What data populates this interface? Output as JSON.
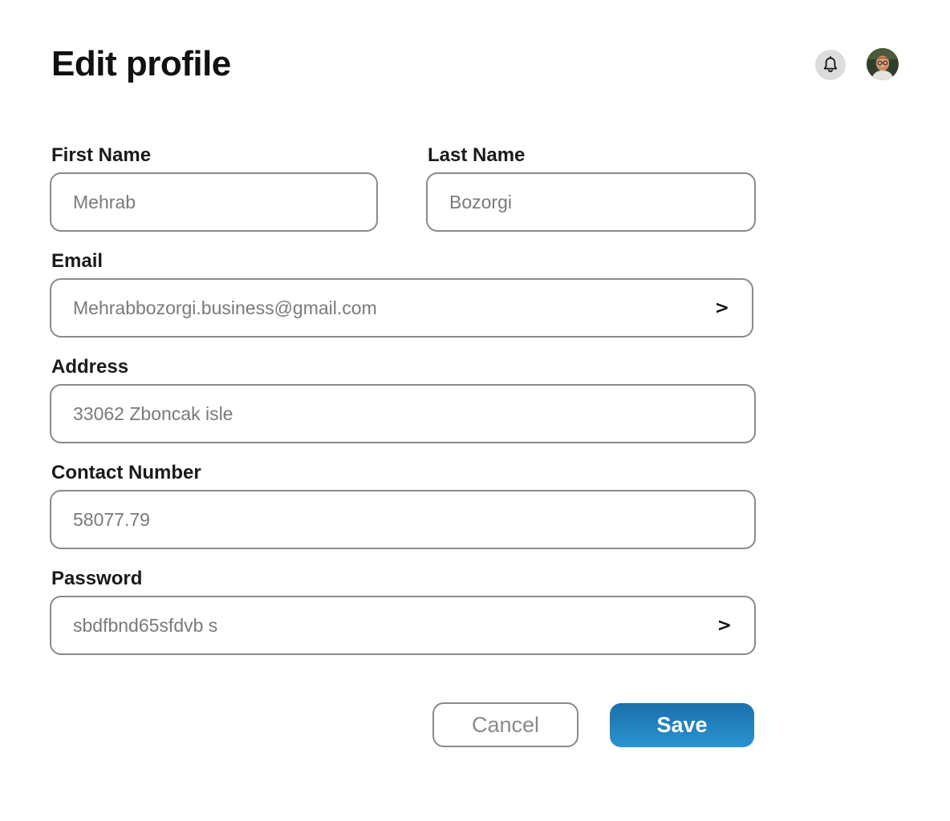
{
  "header": {
    "title": "Edit profile",
    "notification_icon": "bell-icon",
    "avatar_icon": "user-avatar"
  },
  "form": {
    "first_name": {
      "label": "First Name",
      "value": "Mehrab"
    },
    "last_name": {
      "label": "Last Name",
      "value": "Bozorgi"
    },
    "email": {
      "label": "Email",
      "value": "Mehrabbozorgi.business@gmail.com",
      "action": ">"
    },
    "address": {
      "label": "Address",
      "value": "33062 Zboncak isle"
    },
    "contact": {
      "label": "Contact Number",
      "value": "58077.79"
    },
    "password": {
      "label": "Password",
      "value": "sbdfbnd65sfdvb s",
      "action": ">"
    }
  },
  "actions": {
    "cancel_label": "Cancel",
    "save_label": "Save"
  },
  "colors": {
    "accent": "#1f7dbd",
    "border": "#8a8a8a",
    "placeholder_text": "#7a7a7a"
  }
}
